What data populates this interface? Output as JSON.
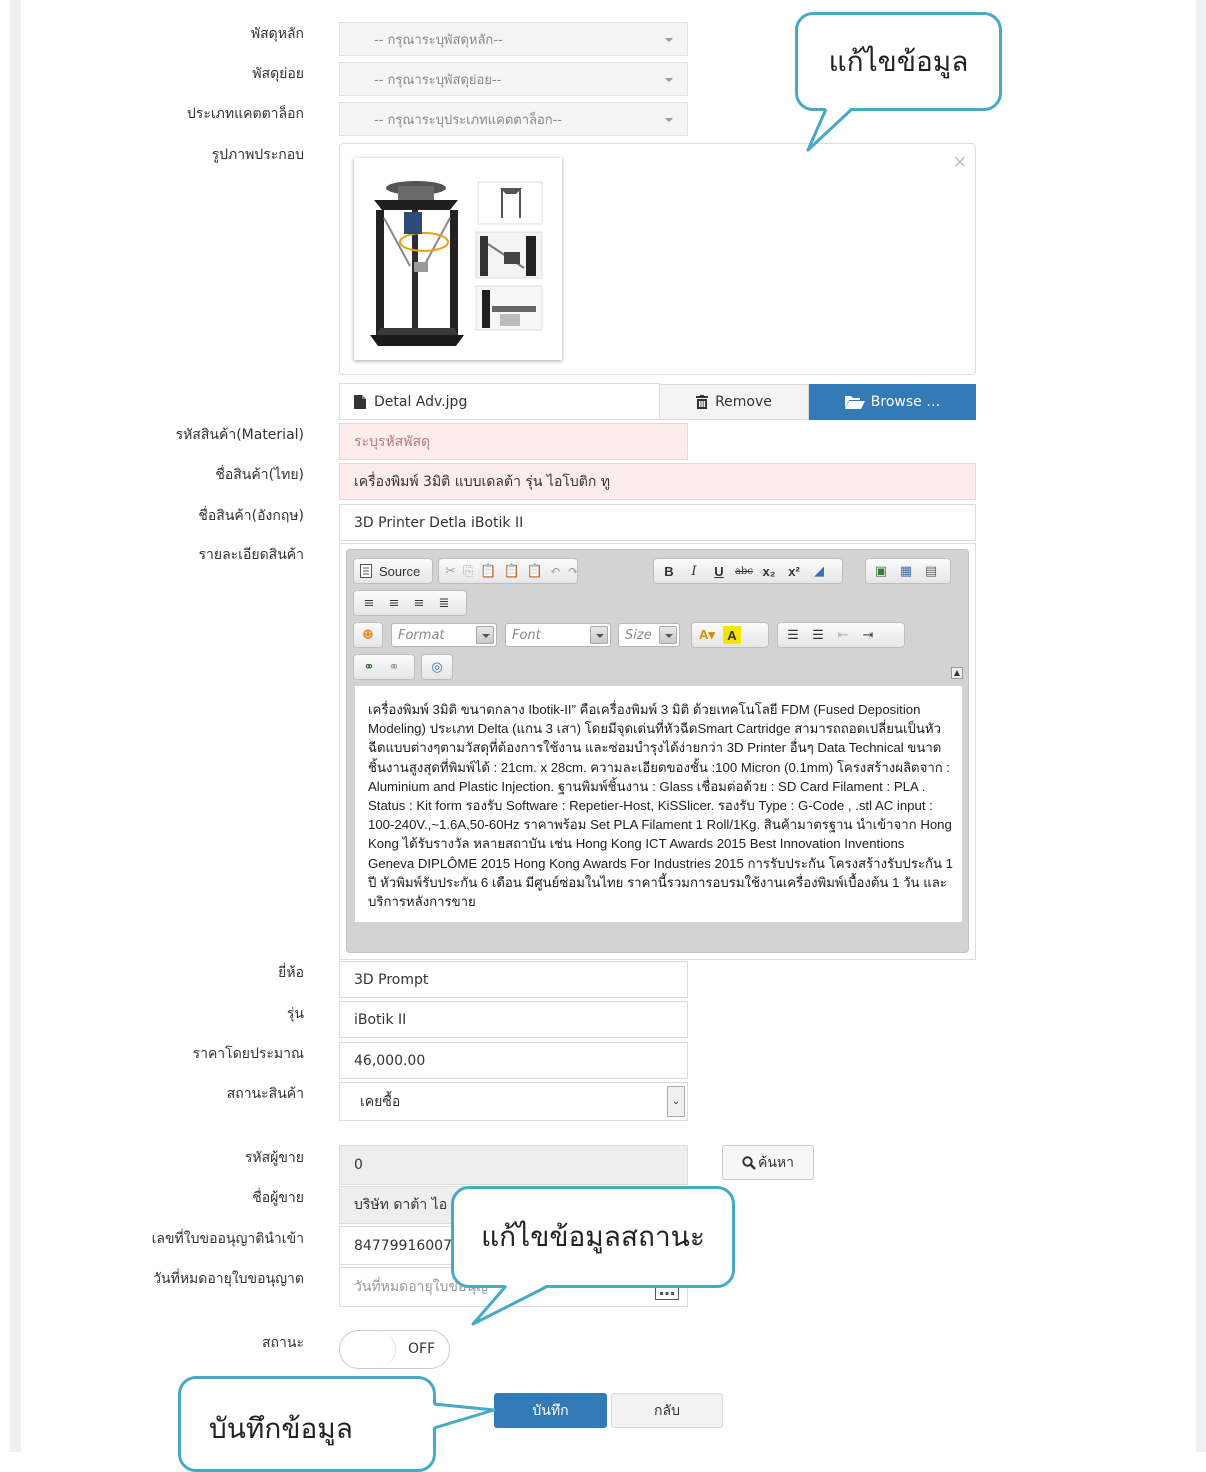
{
  "form": {
    "labels": {
      "main_supply": "พัสดุหลัก",
      "sub_supply": "พัสดุย่อย",
      "catalog_type": "ประเภทแคตตาล็อก",
      "image": "รูปภาพประกอบ",
      "material_code": "รหัสสินค้า(Material)",
      "name_th": "ชื่อสินค้า(ไทย)",
      "name_en": "ชื่อสินค้า(อังกฤษ)",
      "details": "รายละเอียดสินค้า",
      "brand": "ยี่ห้อ",
      "model": "รุ่น",
      "price": "ราคาโดยประมาณ",
      "product_status": "สถานะสินค้า",
      "seller_code": "รหัสผู้ขาย",
      "seller_name": "ชื่อผู้ขาย",
      "import_license_no": "เลขที่ใบขออนุญาตินำเข้า",
      "license_expiry": "วันที่หมดอายุใบขอนุญาต",
      "status": "สถานะ"
    },
    "selects": {
      "main_supply_placeholder": "-- กรุณาระบุพัสดุหลัก--",
      "sub_supply_placeholder": "-- กรุณาระบุพัสดุย่อย--",
      "catalog_type_placeholder": "-- กรุณาระบุประเภทแคตตาล็อก--"
    },
    "file": {
      "name": "Detal Adv.jpg",
      "remove_label": "Remove",
      "browse_label": "Browse …",
      "close_symbol": "×"
    },
    "inputs": {
      "material_placeholder": "ระบุรหัสพัสดุ",
      "name_th": "เครื่องพิมพ์ 3มิติ แบบเดลต้า รุ่น ไอโบติก ทู",
      "name_en": "3D Printer Detla iBotik II",
      "brand": "3D Prompt",
      "model": "iBotik II",
      "price": "46,000.00",
      "product_status": "เคยซื้อ",
      "seller_code": "0",
      "seller_name": "บริษัท ดาต้า ไอ",
      "import_license_no": "847799160070",
      "license_expiry_placeholder": "วันที่หมดอายุใบขอนุญ"
    },
    "search_label": "ค้นหา",
    "toggle_label": "OFF",
    "save_label": "บันทึก",
    "back_label": "กลับ"
  },
  "editor": {
    "source_label": "Source",
    "format_placeholder": "Format",
    "font_placeholder": "Font",
    "size_placeholder": "Size",
    "content": "เครื่องพิมพ์ 3มิติ ขนาดกลาง Ibotik-II” คือเครื่องพิมพ์ 3 มิติ ด้วยเทคโนโลยี FDM (Fused Deposition Modeling) ประเภท Delta (แกน 3 เสา) โดยมีจุดเด่นที่หัวฉีดSmart Cartridge สามารถถอดเปลี่ยนเป็นหัวฉีดแบบต่างๆตามวัสดุที่ต้องการใช้งาน และซ่อมบำรุงได้ง่ายกว่า 3D Printer อื่นๆ Data Technical ขนาดชิ้นงานสูงสุดที่พิมพ์ได้ : 21cm. x 28cm.  ความละเอียดของชั้น :100 Micron (0.1mm) โครงสร้างผลิตจาก  : Aluminium and Plastic Injection. ฐานพิมพ์ชิ้นงาน : Glass เชื่อมต่อด้วย : SD Card Filament : PLA . Status : Kit form รองรับ Software  : Repetier-Host, KiSSlicer. รองรับ Type : G-Code , .stl AC input : 100-240V.,~1.6A,50-60Hz ราคาพร้อม Set PLA Filament 1 Roll/1Kg.   สินค้ามาตรฐาน นำเข้าจาก Hong Kong ได้รับรางวัล หลายสถาบัน เช่น Hong Kong ICT Awards 2015 Best Innovation Inventions Geneva DIPLÔME 2015 Hong Kong Awards For Industries 2015 การรับประกัน โครงสร้างรับประกัน 1 ปี หัวพิมพ์รับประกัน 6 เดือน มีศูนย์ซ่อมในไทย ราคานี้รวมการอบรมใช้งานเครื่องพิมพ์เบื้องต้น 1 วัน และบริการหลังการขาย"
  },
  "callouts": {
    "edit_data": "แก้ไขข้อมูล",
    "edit_status": "แก้ไขข้อมูลสถานะ",
    "save_data": "บันทึกข้อมูล"
  },
  "colors": {
    "primary": "#337ab7",
    "callout_border": "#47a9c6",
    "required_bg": "#fdecec"
  }
}
